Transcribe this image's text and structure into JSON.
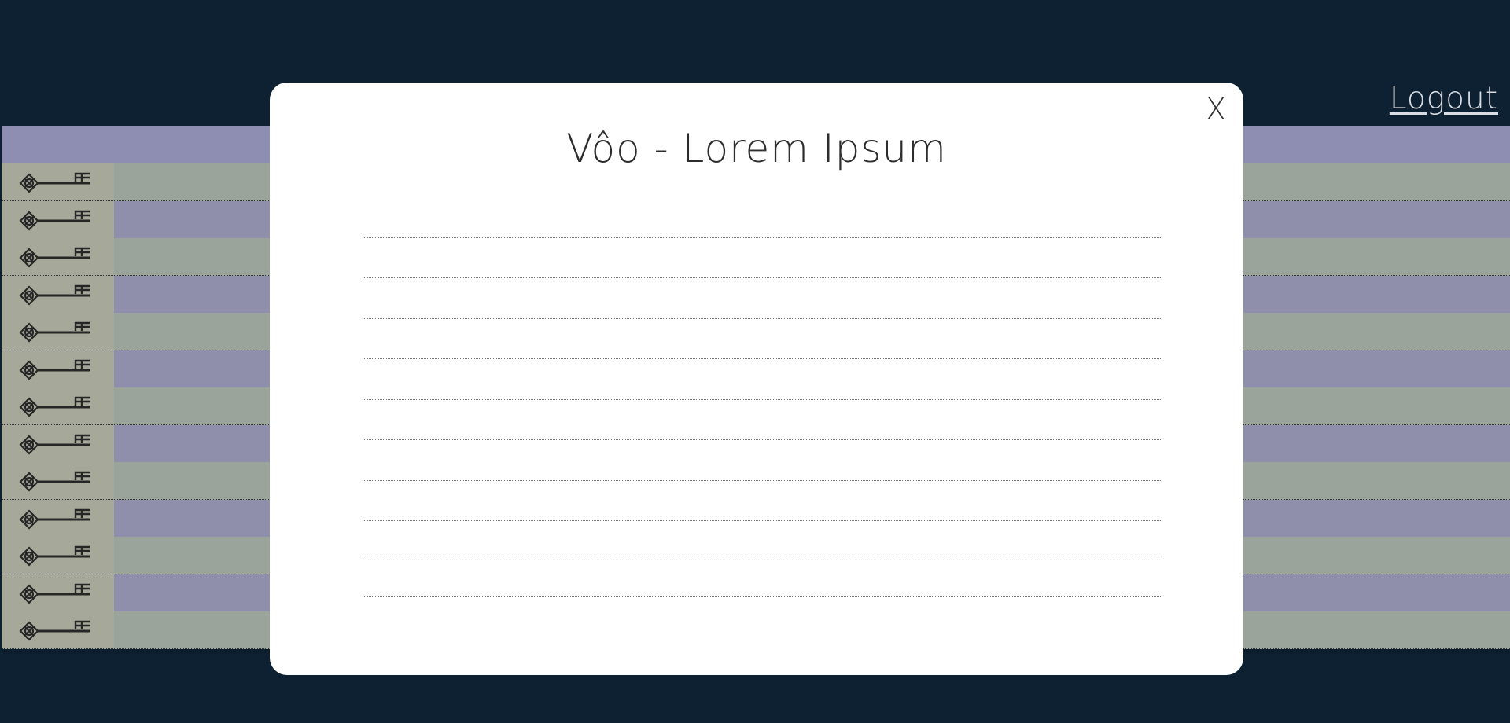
{
  "header": {
    "logout_label": "Logout"
  },
  "table": {
    "row_count": 13,
    "key_icon": "key-icon"
  },
  "modal": {
    "title": "Vôo - Lorem Ipsum",
    "close_label": "X",
    "line_count": 10
  },
  "colors": {
    "page_bg": "#0e2132",
    "header_row": "#9a9bc0",
    "row_green": "#a8b2a8",
    "row_purple": "#9c9cba",
    "modal_bg": "#ffffff"
  }
}
